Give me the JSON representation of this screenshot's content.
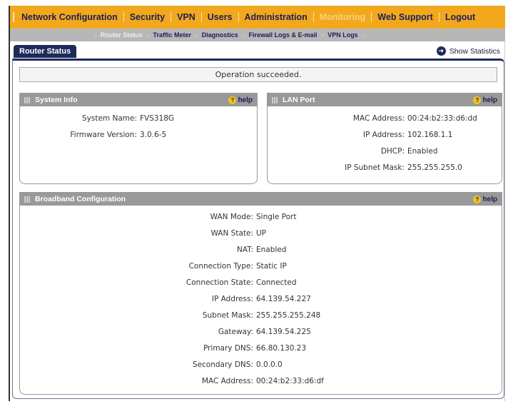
{
  "topnav": {
    "items": [
      "Network Configuration",
      "Security",
      "VPN",
      "Users",
      "Administration",
      "Monitoring",
      "Web Support",
      "Logout"
    ],
    "active_index": 5
  },
  "subnav": {
    "items": [
      "Router Status",
      "Traffic Meter",
      "Diagnostics",
      "Firewall Logs & E-mail",
      "VPN Logs"
    ],
    "active_index": 0
  },
  "tab": {
    "label": "Router Status"
  },
  "show_statistics": {
    "label": "Show Statistics"
  },
  "status_message": "Operation succeeded.",
  "system_info": {
    "title": "System Info",
    "help": "help",
    "rows": [
      {
        "label": "System Name:",
        "value": "FVS318G"
      },
      {
        "label": "Firmware Version:",
        "value": "3.0.6-5"
      }
    ]
  },
  "lan_port": {
    "title": "LAN Port",
    "help": "help",
    "rows": [
      {
        "label": "MAC Address:",
        "value": "00:24:b2:33:d6:dd"
      },
      {
        "label": "IP Address:",
        "value": "102.168.1.1"
      },
      {
        "label": "DHCP:",
        "value": "Enabled"
      },
      {
        "label": "IP Subnet Mask:",
        "value": "255.255.255.0"
      }
    ]
  },
  "broadband": {
    "title": "Broadband Configuration",
    "help": "help",
    "rows": [
      {
        "label": "WAN Mode:",
        "value": "Single Port"
      },
      {
        "label": "WAN State:",
        "value": "UP"
      },
      {
        "label": "NAT:",
        "value": "Enabled"
      },
      {
        "label": "Connection Type:",
        "value": "Static IP"
      },
      {
        "label": "Connection State:",
        "value": "Connected"
      },
      {
        "label": "IP Address:",
        "value": "64.139.54.227"
      },
      {
        "label": "Subnet Mask:",
        "value": "255.255.255.248"
      },
      {
        "label": "Gateway:",
        "value": "64.139.54.225"
      },
      {
        "label": "Primary DNS:",
        "value": "66.80.130.23"
      },
      {
        "label": "Secondary DNS:",
        "value": "0.0.0.0"
      },
      {
        "label": "MAC Address:",
        "value": "00:24:b2:33:d6:df"
      }
    ]
  },
  "colors": {
    "nav_orange": "#f2a81d",
    "nav_text": "#1d1d5a",
    "subnav_gray": "#b7b7b7",
    "tab_navy": "#1e2a5a",
    "panel_header": "#999999",
    "help_icon": "#f2c21d"
  },
  "icons": {
    "show_statistics": "arrow-circle-icon",
    "help": "question-circle-icon",
    "panel_grip": "grip-icon"
  }
}
